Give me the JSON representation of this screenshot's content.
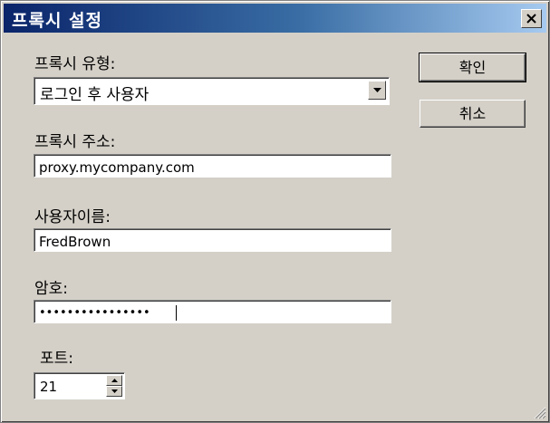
{
  "window": {
    "title": "프록시 설정",
    "close_icon": "close-icon"
  },
  "form": {
    "proxy_type": {
      "label": "프록시 유형:",
      "value": "로그인 후 사용자"
    },
    "proxy_address": {
      "label": "프록시 주소:",
      "value": "proxy.mycompany.com"
    },
    "username": {
      "label": "사용자이름:",
      "value": "FredBrown"
    },
    "password": {
      "label": "암호:",
      "value": "••••••••••••••••"
    },
    "port": {
      "label": "포트:",
      "value": "21"
    }
  },
  "buttons": {
    "ok_label": "확인",
    "cancel_label": "취소"
  },
  "colors": {
    "dialog_bg": "#d4d0c8",
    "title_start": "#0a246a",
    "title_end": "#a6caf0"
  }
}
